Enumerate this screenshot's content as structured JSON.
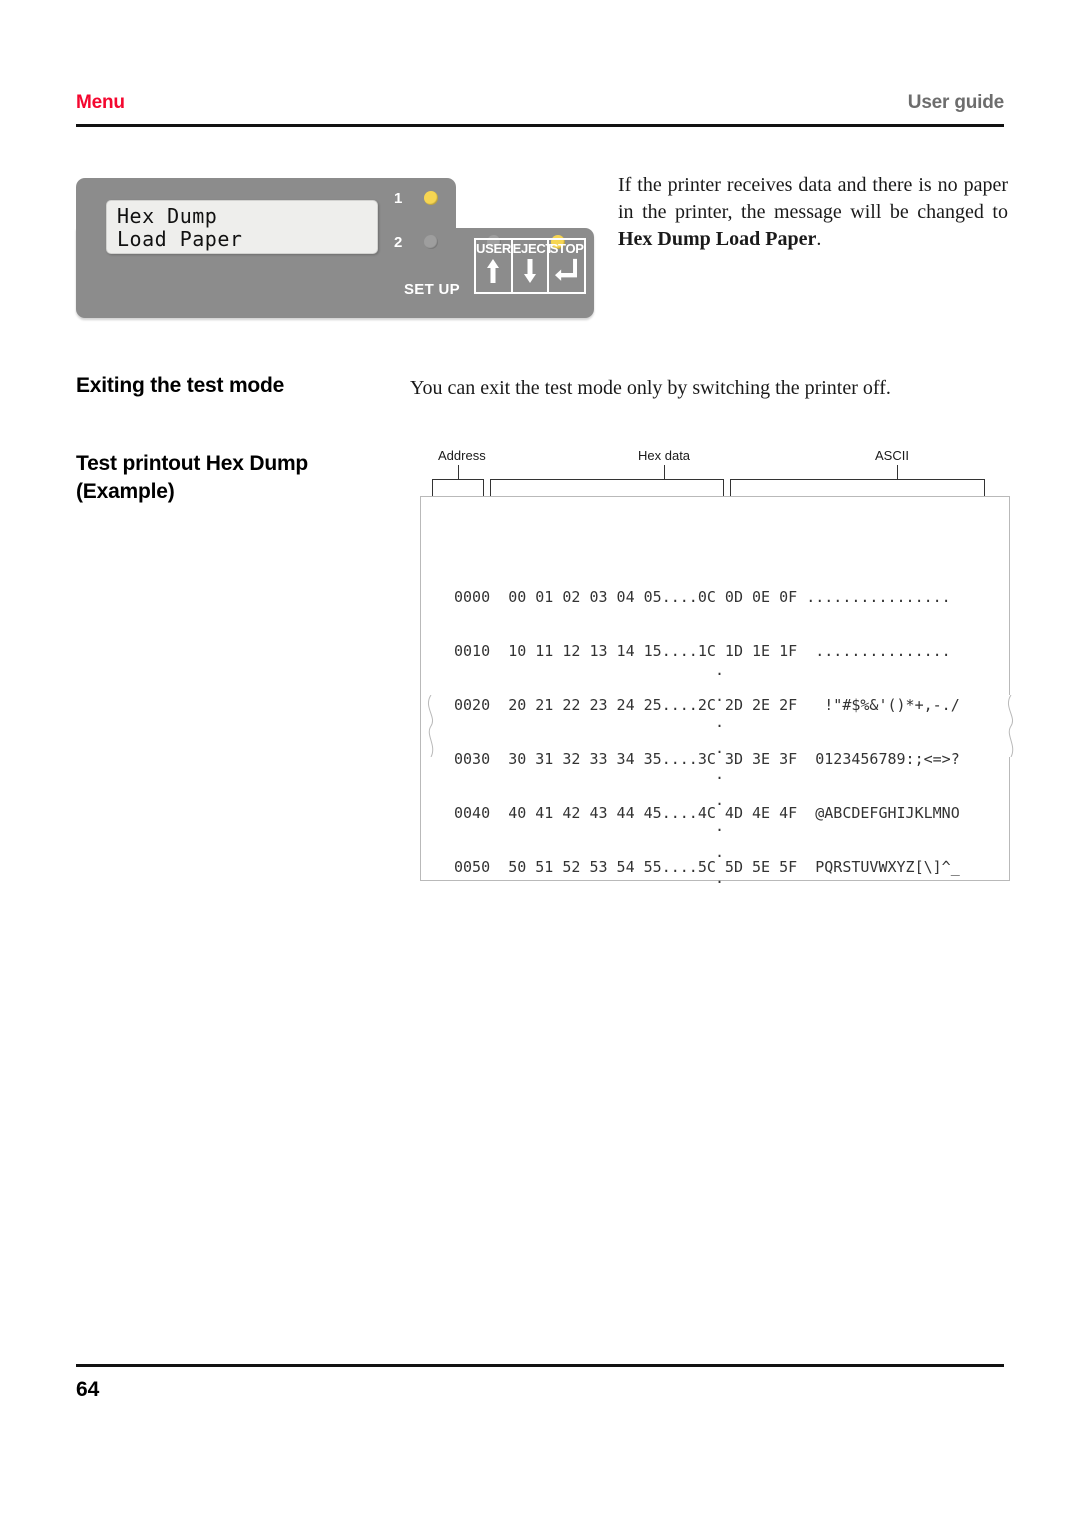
{
  "header": {
    "title": "Menu",
    "guide": "User guide",
    "title_color": "#f4072f",
    "guide_color": "#6d6d6d"
  },
  "control_panel": {
    "lcd": {
      "line1": "Hex Dump",
      "line2": "Load Paper"
    },
    "led_group_1_label": "1",
    "led_group_2_label": "2",
    "leds_row1": [
      {
        "name": "led-1-a",
        "state": "on"
      }
    ],
    "leds_row2": [
      {
        "name": "led-2-a",
        "state": "off"
      },
      {
        "name": "led-2-b",
        "state": "off"
      },
      {
        "name": "led-2-c",
        "state": "on"
      }
    ],
    "setup_label": "SET UP",
    "buttons": [
      {
        "label": "USER",
        "glyph": "arrow-up-icon"
      },
      {
        "label": "EJECT",
        "glyph": "arrow-down-icon"
      },
      {
        "label": "STOP",
        "glyph": "enter-return-icon"
      }
    ],
    "colors": {
      "panel": "#8c8c8c",
      "lcd": "#eeeeec",
      "led_on": "#f6d552",
      "led_off": "#9e9e9e"
    }
  },
  "intro": {
    "text_part1": "If the printer receives data and there is no paper in the printer, the message will be changed to ",
    "bold_part": "Hex Dump Load Paper",
    "text_part2": "."
  },
  "sections": [
    {
      "heading": "Exiting the test mode",
      "body": "You can exit the test mode only by switching the printer off."
    },
    {
      "heading_line1": "Test printout Hex Dump",
      "heading_line2": "(Example)"
    }
  ],
  "figure": {
    "callouts": [
      {
        "label": "Address"
      },
      {
        "label": "Hex data"
      },
      {
        "label": "ASCII"
      }
    ],
    "rows": [
      {
        "address": "0000",
        "hex": "00 01 02 03 04 05....0C 0D 0E 0F",
        "ascii": "................"
      },
      {
        "address": "0010",
        "hex": "10 11 12 13 14 15....1C 1D 1E 1F",
        "ascii": " ..............."
      },
      {
        "address": "0020",
        "hex": "20 21 22 23 24 25....2C 2D 2E 2F",
        "ascii": "  !\"#$%&'()*+,-./"
      },
      {
        "address": "0030",
        "hex": "30 31 32 33 34 35....3C 3D 3E 3F",
        "ascii": " 0123456789:;<=>?"
      },
      {
        "address": "0040",
        "hex": "40 41 42 43 44 45....4C 4D 4E 4F",
        "ascii": " @ABCDEFGHIJKLMNO"
      },
      {
        "address": "0050",
        "hex": "50 51 52 53 54 55....5C 5D 5E 5F",
        "ascii": " PQRSTUVWXYZ[\\]^_"
      }
    ],
    "continuation_dots": 9,
    "continuation_glyph": "."
  },
  "footer": {
    "page_number": "64"
  }
}
